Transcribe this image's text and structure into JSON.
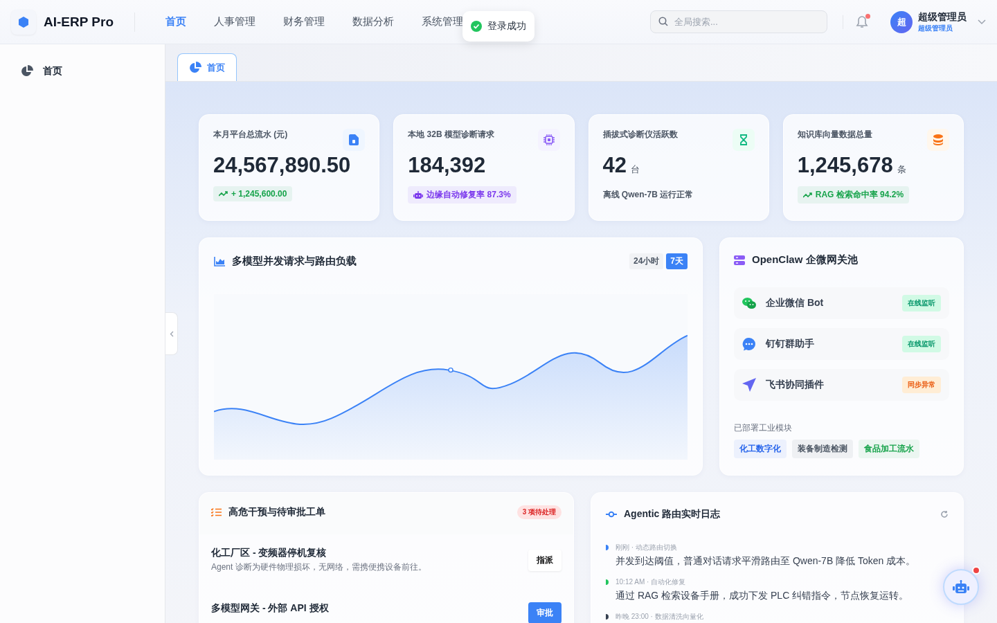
{
  "brand": {
    "name": "AI-ERP Pro"
  },
  "nav": [
    {
      "label": "首页",
      "selected": true
    },
    {
      "label": "人事管理",
      "selected": false
    },
    {
      "label": "财务管理",
      "selected": false
    },
    {
      "label": "数据分析",
      "selected": false
    },
    {
      "label": "系统管理",
      "selected": false
    }
  ],
  "toast": {
    "text": "登录成功"
  },
  "search": {
    "placeholder": "全局搜索..."
  },
  "notifications": {
    "unread": true
  },
  "user": {
    "avatar": "超",
    "name": "超级管理员",
    "role": "超级管理员"
  },
  "sidebar": {
    "items": [
      {
        "label": "首页",
        "selected": true
      }
    ]
  },
  "tabs": [
    {
      "label": "首页",
      "selected": true
    }
  ],
  "stats": [
    {
      "label": "本月平台总流水 (元)",
      "value": "24,567,890.50",
      "footer": {
        "kind": "trend",
        "text": "+ 1,245,600.00",
        "color": "#16a34a"
      }
    },
    {
      "label": "本地 32B 模型诊断请求",
      "value": "184,392",
      "footer": {
        "kind": "robot",
        "text": "边缘自动修复率 87.3%",
        "color": "#7c3aed"
      }
    },
    {
      "label": "插拔式诊断仪活跃数",
      "value": "42",
      "unit": "台",
      "footer": {
        "kind": "plain",
        "text": "离线 Qwen-7B 运行正常"
      }
    },
    {
      "label": "知识库向量数据总量",
      "value": "1,245,678",
      "unit": "条",
      "footer": {
        "kind": "trend",
        "text": "RAG 检索命中率 94.2%",
        "color": "#16a34a"
      }
    }
  ],
  "chart_panel": {
    "title": "多模型并发请求与路由负载",
    "ranges": [
      {
        "label": "24小时",
        "selected": false
      },
      {
        "label": "7天",
        "selected": true
      }
    ]
  },
  "gateway": {
    "title": "OpenClaw 企微网关池",
    "channels": [
      {
        "name": "企业微信 Bot",
        "status": "在线监听",
        "kind": "ok"
      },
      {
        "name": "钉钉群助手",
        "status": "在线监听",
        "kind": "ok"
      },
      {
        "name": "飞书协同插件",
        "status": "同步异常",
        "kind": "warn"
      }
    ],
    "modules_label": "已部署工业模块",
    "modules": [
      {
        "label": "化工数字化",
        "color": "#2563eb"
      },
      {
        "label": "装备制造检测",
        "color": "#4b5563"
      },
      {
        "label": "食品加工流水",
        "color": "#16a34a"
      }
    ]
  },
  "tickets": {
    "title": "高危干预与待审批工单",
    "badge": "3 项待处理",
    "items": [
      {
        "title": "化工厂区 - 变频器停机复核",
        "desc": "Agent 诊断为硬件物理损坏，无网络，需携便携设备前往。",
        "action": "指派",
        "kind": "secondary"
      },
      {
        "title": "多模型网关 - 外部 API 授权",
        "action": "审批",
        "kind": "primary"
      }
    ]
  },
  "log": {
    "title": "Agentic 路由实时日志",
    "entries": [
      {
        "meta": "刚刚 · 动态路由切换",
        "text": "并发到达阈值，普通对话请求平滑路由至 Qwen-7B 降低 Token 成本。",
        "color": "#3b82f6"
      },
      {
        "meta": "10:12 AM · 自动化修复",
        "text": "通过 RAG 检索设备手册，成功下发 PLC 纠错指令，节点恢复运转。",
        "color": "#22c55e"
      },
      {
        "meta": "昨晚 23:00 · 数据清洗向量化",
        "color": "#374151"
      }
    ]
  },
  "assistant": {
    "unread": true
  }
}
